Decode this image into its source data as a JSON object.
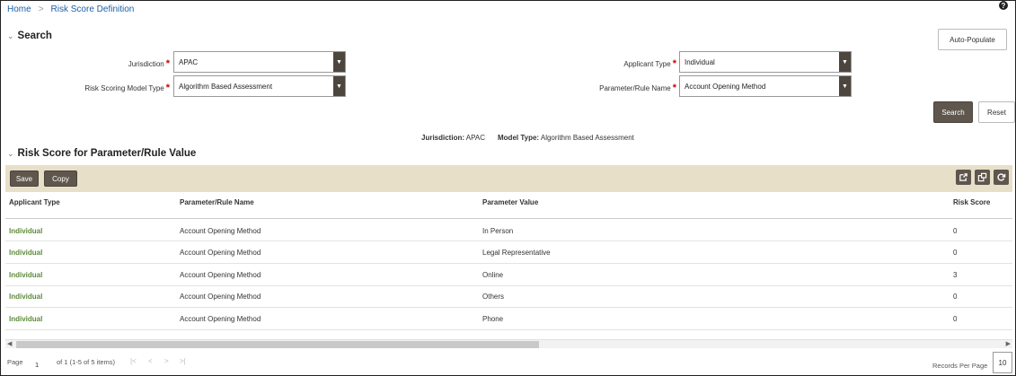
{
  "breadcrumb": {
    "home": "Home",
    "separator": ">",
    "current": "Risk Score Definition"
  },
  "help_icon": "?",
  "search_section": {
    "title": "Search",
    "auto_populate_label": "Auto-Populate",
    "fields": {
      "jurisdiction": {
        "label": "Jurisdiction",
        "value": "APAC"
      },
      "risk_model": {
        "label": "Risk Scoring Model Type",
        "value": "Algorithm Based Assessment"
      },
      "applicant_type": {
        "label": "Applicant Type",
        "value": "Individual"
      },
      "parameter": {
        "label": "Parameter/Rule Name",
        "value": "Account Opening Method"
      }
    },
    "required_mark": "*",
    "search_label": "Search",
    "reset_label": "Reset"
  },
  "summary": {
    "jurisdiction_label": "Jurisdiction:",
    "jurisdiction_value": "APAC",
    "model_label": "Model Type:",
    "model_value": "Algorithm Based Assessment"
  },
  "results_section": {
    "title": "Risk Score for Parameter/Rule Value",
    "save_label": "Save",
    "copy_label": "Copy",
    "toolbar_icons": [
      "export-icon",
      "column-settings-icon",
      "refresh-icon"
    ],
    "columns": [
      "Applicant Type",
      "Parameter/Rule Name",
      "Parameter Value",
      "Risk Score"
    ],
    "rows": [
      [
        "Individual",
        "Account Opening Method",
        "In Person",
        "0"
      ],
      [
        "Individual",
        "Account Opening Method",
        "Legal Representative",
        "0"
      ],
      [
        "Individual",
        "Account Opening Method",
        "Online",
        "3"
      ],
      [
        "Individual",
        "Account Opening Method",
        "Others",
        "0"
      ],
      [
        "Individual",
        "Account Opening Method",
        "Phone",
        "0"
      ]
    ]
  },
  "pagination": {
    "page_label": "Page",
    "page_value": "1",
    "of_text": "of 1 (1-5 of 5 items)",
    "nav": [
      "|<",
      "<",
      ">",
      ">|"
    ],
    "records_per_page_label": "Records Per Page",
    "records_per_page_value": "10"
  },
  "colors": {
    "link_green": "#5e8a3a",
    "toolbar_bg": "#e7dfc8",
    "dark_button": "#5f574d",
    "breadcrumb_blue": "#1a5fa8"
  }
}
